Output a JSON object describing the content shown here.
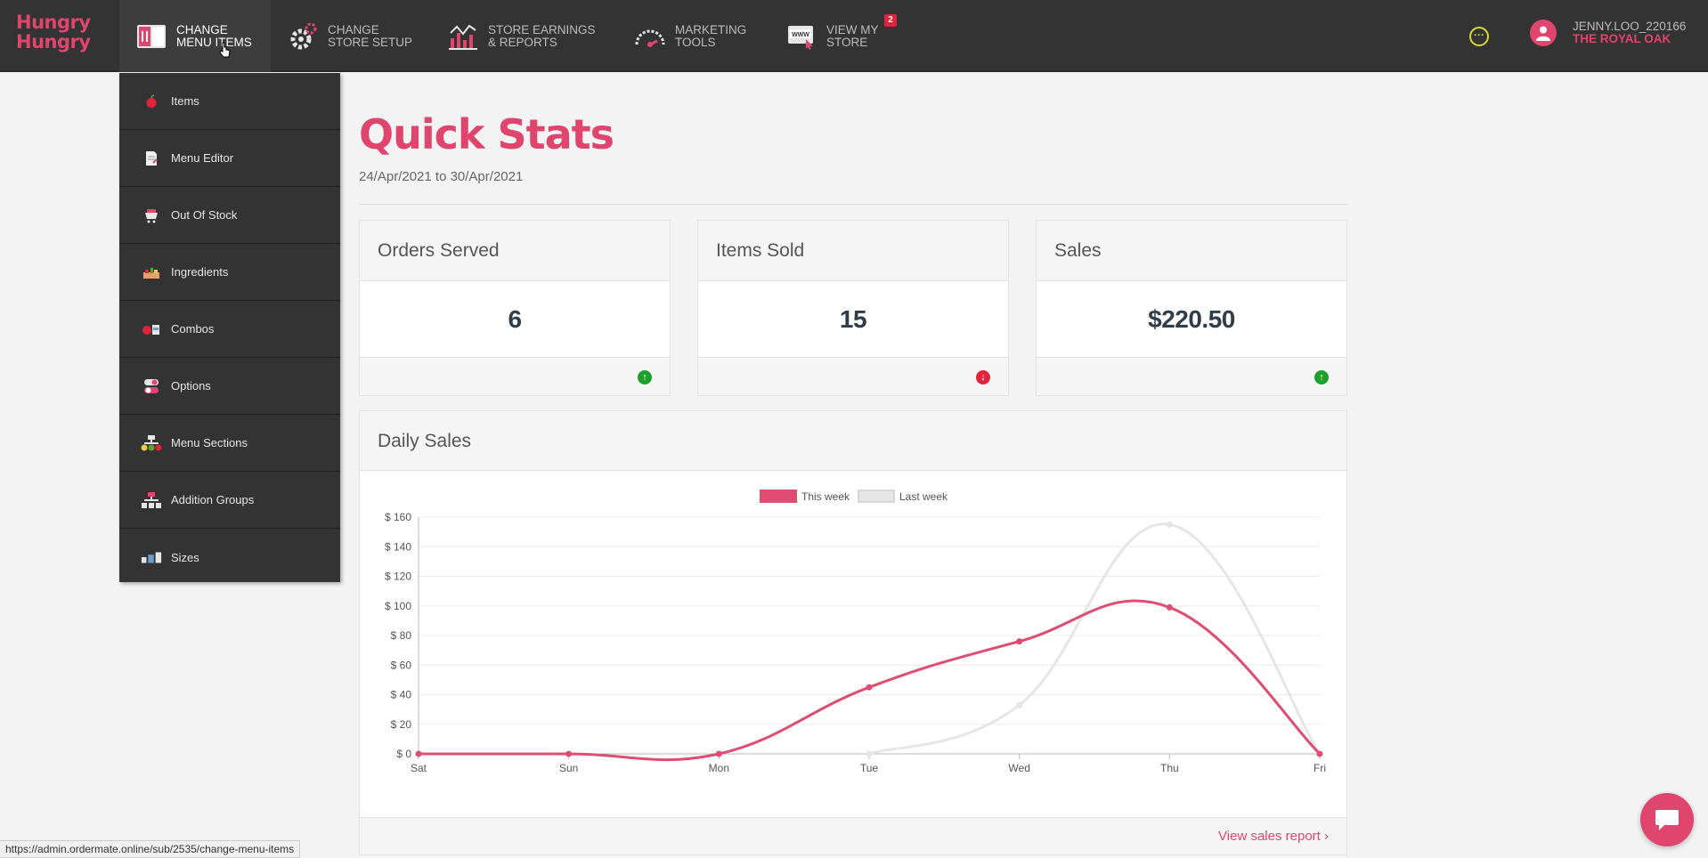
{
  "logo": {
    "line1": "Hungry",
    "line2": "Hungry"
  },
  "nav": [
    {
      "line1": "CHANGE",
      "line2": "MENU ITEMS",
      "icon": "menu-book-icon"
    },
    {
      "line1": "CHANGE",
      "line2": "STORE SETUP",
      "icon": "gear-icon"
    },
    {
      "line1": "STORE EARNINGS",
      "line2": "& REPORTS",
      "icon": "bar-chart-icon"
    },
    {
      "line1": "MARKETING",
      "line2": "TOOLS",
      "icon": "gauge-icon"
    },
    {
      "line1": "VIEW MY",
      "line2": "STORE",
      "icon": "www-icon",
      "badge": "2"
    }
  ],
  "more": {
    "label": "···"
  },
  "user": {
    "name": "JENNY.LOO_220166",
    "store": "THE ROYAL OAK"
  },
  "dropdown": [
    {
      "label": "Items",
      "icon": "apple-icon"
    },
    {
      "label": "Menu Editor",
      "icon": "document-icon"
    },
    {
      "label": "Out Of Stock",
      "icon": "cart-icon"
    },
    {
      "label": "Ingredients",
      "icon": "ingredients-icon"
    },
    {
      "label": "Combos",
      "icon": "combo-icon"
    },
    {
      "label": "Options",
      "icon": "toggle-icon"
    },
    {
      "label": "Menu Sections",
      "icon": "sections-icon"
    },
    {
      "label": "Addition Groups",
      "icon": "groups-icon"
    },
    {
      "label": "Sizes",
      "icon": "sizes-icon"
    }
  ],
  "page": {
    "title": "Quick Stats",
    "date_range": "24/Apr/2021 to 30/Apr/2021"
  },
  "stats": [
    {
      "label": "Orders Served",
      "value": "6",
      "trend": "up"
    },
    {
      "label": "Items Sold",
      "value": "15",
      "trend": "down"
    },
    {
      "label": "Sales",
      "value": "$220.50",
      "trend": "up"
    }
  ],
  "daily_sales": {
    "title": "Daily Sales",
    "link": "View sales report"
  },
  "chart_data": {
    "type": "line",
    "categories": [
      "Sat",
      "Sun",
      "Mon",
      "Tue",
      "Wed",
      "Thu",
      "Fri"
    ],
    "series": [
      {
        "name": "This week",
        "values": [
          0,
          0,
          0,
          45,
          76,
          99,
          0
        ],
        "color": "#df4d72"
      },
      {
        "name": "Last week",
        "values": [
          null,
          null,
          null,
          0,
          33,
          155,
          0
        ],
        "color": "#e6e6e6"
      }
    ],
    "ylim": [
      0,
      160
    ],
    "yticks": [
      0,
      20,
      40,
      60,
      80,
      100,
      120,
      140,
      160
    ],
    "ytick_labels": [
      "$ 0",
      "$ 20",
      "$ 40",
      "$ 60",
      "$ 80",
      "$ 100",
      "$ 120",
      "$ 140",
      "$ 160"
    ],
    "legend": "top",
    "grid": true
  },
  "status_url": "https://admin.ordermate.online/sub/2535/change-menu-items"
}
